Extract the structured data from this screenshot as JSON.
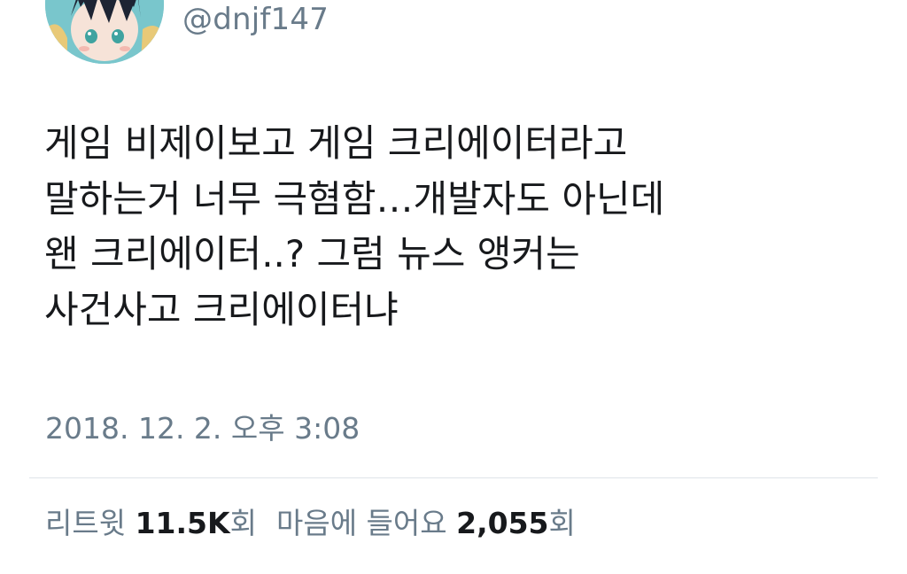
{
  "tweet": {
    "handle": "@dnjf147",
    "text_lines": [
      "게임 비제이보고 게임 크리에이터라고",
      "말하는거 너무 극혐함…개발자도 아닌데",
      "왠 크리에이터..?  그럼 뉴스 앵커는",
      "사건사고 크리에이터냐"
    ],
    "timestamp": "2018. 12. 2. 오후 3:08"
  },
  "stats": {
    "retweet_label": "리트윗",
    "retweet_count": "11.5K",
    "retweet_suffix": "회",
    "like_label": "마음에 들어요",
    "like_count": "2,055",
    "like_suffix": "회"
  },
  "colors": {
    "text": "#17191c",
    "secondary": "#697b8a",
    "divider": "#dfe4e8"
  }
}
